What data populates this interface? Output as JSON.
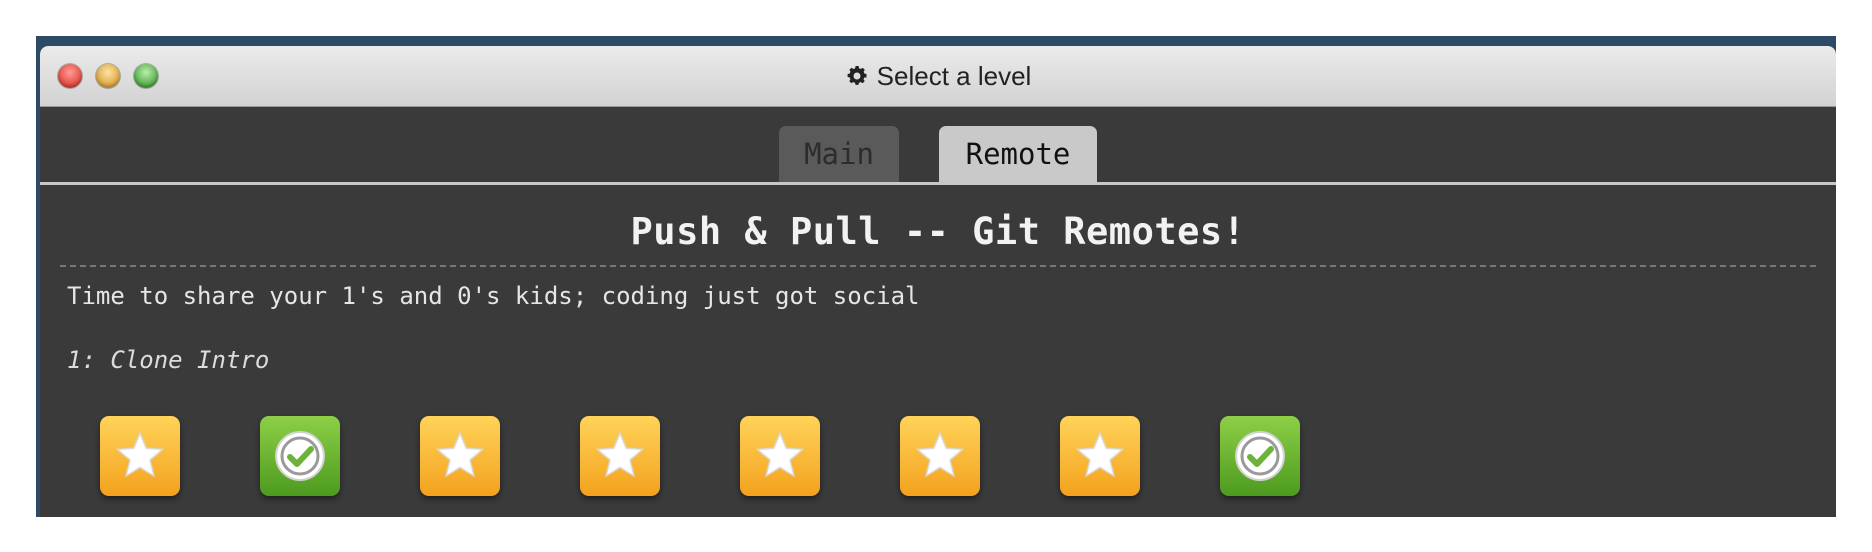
{
  "window": {
    "title": "Select a level",
    "title_icon": "gear-icon"
  },
  "tabs": [
    {
      "label": "Main",
      "selected": false
    },
    {
      "label": "Remote",
      "selected": true
    }
  ],
  "sequence": {
    "heading": "Push & Pull -- Git Remotes!",
    "about": "Time to share your 1's and 0's kids; coding just got social",
    "level_name": "1: Clone Intro"
  },
  "levels": [
    {
      "status": "star",
      "icon": "star-icon"
    },
    {
      "status": "done",
      "icon": "check-icon"
    },
    {
      "status": "star",
      "icon": "star-icon"
    },
    {
      "status": "star",
      "icon": "star-icon"
    },
    {
      "status": "star",
      "icon": "star-icon"
    },
    {
      "status": "star",
      "icon": "star-icon"
    },
    {
      "status": "star",
      "icon": "star-icon"
    },
    {
      "status": "done",
      "icon": "check-icon"
    }
  ],
  "colors": {
    "window_bg": "#3a3a3a",
    "star_box": "#f7b733",
    "done_box": "#6db33a",
    "active_tab": "#c9c9c9",
    "inactive_tab": "#5a5a5a"
  }
}
